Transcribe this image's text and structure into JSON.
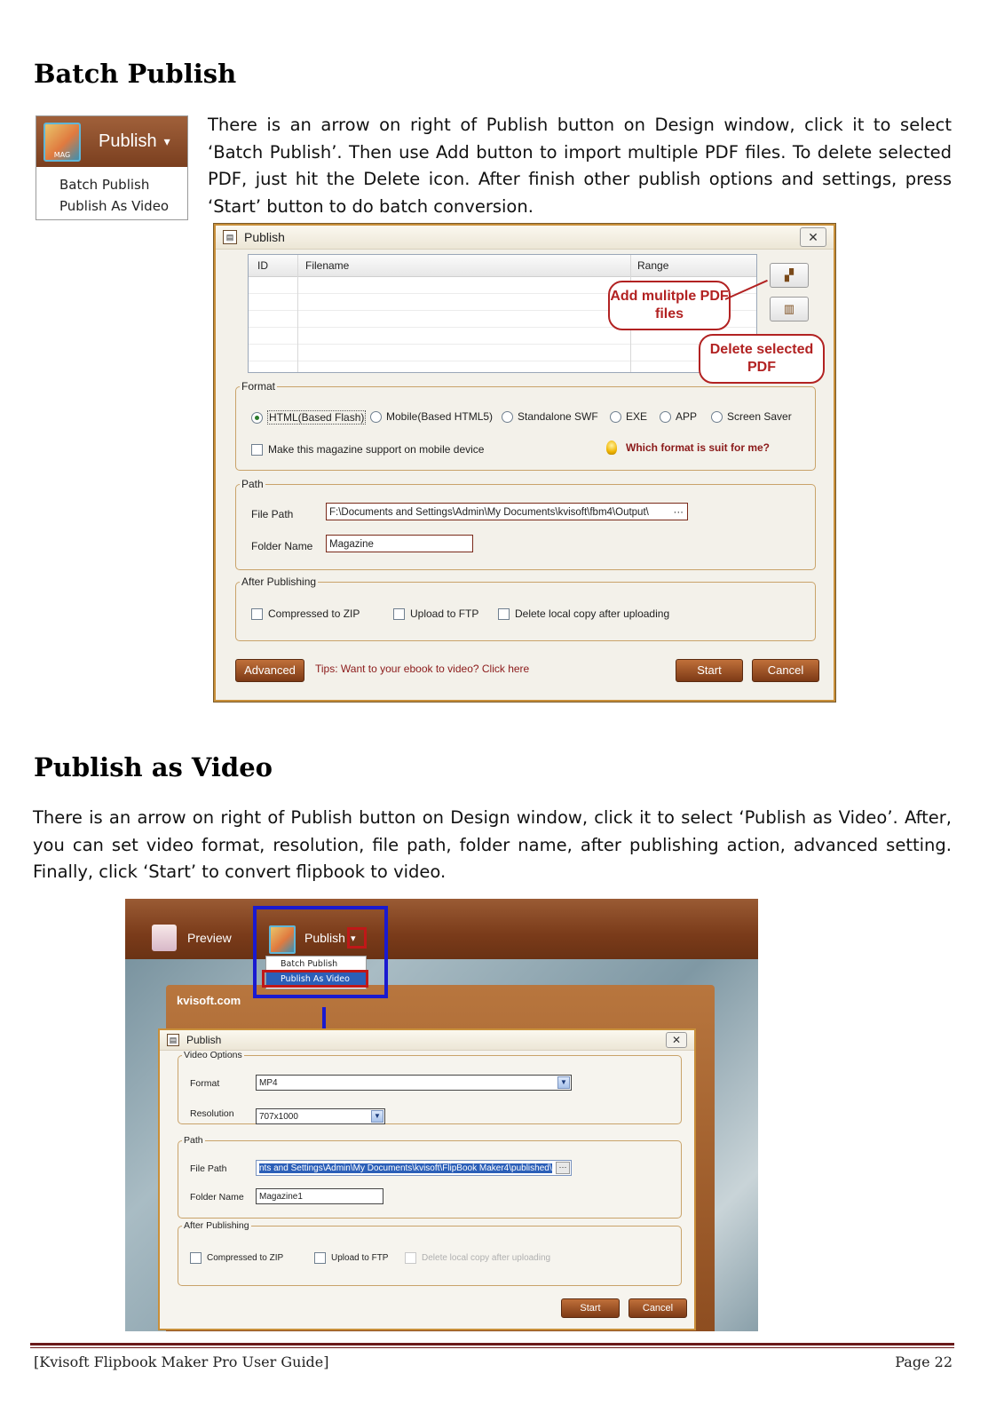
{
  "section1": {
    "heading": "Batch Publish",
    "paragraph": "There is an arrow on right of Publish button on Design window, click it to select ‘Batch Publish’. Then use Add button to import multiple PDF files. To delete selected PDF, just hit the Delete icon. After finish other publish options and settings, press ‘Start’ button to do batch conversion."
  },
  "menu_figure": {
    "icon_text": "MAG",
    "button_label": "Publish",
    "arrow": "▾",
    "items": [
      "Batch Publish",
      "Publish As Video"
    ]
  },
  "dialog1": {
    "title": "Publish",
    "close": "✕",
    "grid_columns": [
      "ID",
      "Filename",
      "Range"
    ],
    "add_icon": "add-files-icon",
    "delete_icon": "trash-icon",
    "callout_add": "Add mulitple PDF files",
    "callout_delete": "Delete selected PDF",
    "format": {
      "legend": "Format",
      "options": [
        "HTML(Based Flash)",
        "Mobile(Based HTML5)",
        "Standalone SWF",
        "EXE",
        "APP",
        "Screen Saver"
      ],
      "selected": "HTML(Based Flash)",
      "mobile_checkbox": "Make this magazine support on mobile device",
      "help_link": "Which format is suit for me?"
    },
    "path": {
      "legend": "Path",
      "file_path_label": "File Path",
      "file_path_value": "F:\\Documents and Settings\\Admin\\My Documents\\kvisoft\\fbm4\\Output\\",
      "browse": "···",
      "folder_name_label": "Folder Name",
      "folder_name_value": "Magazine"
    },
    "after": {
      "legend": "After Publishing",
      "options": [
        "Compressed to ZIP",
        "Upload to FTP",
        "Delete local copy after uploading"
      ]
    },
    "advanced_button": "Advanced",
    "tips": "Tips: Want to your ebook to video? Click here",
    "start_button": "Start",
    "cancel_button": "Cancel"
  },
  "section2": {
    "heading": "Publish as Video",
    "paragraph": "There is an arrow on right of Publish button on Design window, click it to select ‘Publish as Video’. After, you can set video format, resolution, file path, folder name, after publishing action, advanced setting. Finally, click ‘Start’ to convert flipbook to video."
  },
  "figure2": {
    "toolbar": {
      "preview": "Preview",
      "publish": "Publish",
      "arrow": "▾"
    },
    "menu_items": [
      "Batch Publish",
      "Publish As Video"
    ],
    "brand": "kvisoft.com",
    "dialog": {
      "title": "Publish",
      "close": "✕",
      "video_options_legend": "Video Options",
      "format_label": "Format",
      "format_value": "MP4",
      "resolution_label": "Resolution",
      "resolution_value": "707x1000",
      "path_legend": "Path",
      "file_path_label": "File Path",
      "file_path_value": "nts and Settings\\Admin\\My Documents\\kvisoft\\FlipBook Maker4\\published\\",
      "browse": "···",
      "folder_name_label": "Folder Name",
      "folder_name_value": "Magazine1",
      "after_legend": "After Publishing",
      "after_options": [
        "Compressed to ZIP",
        "Upload to FTP",
        "Delete local copy after uploading"
      ],
      "start_button": "Start",
      "cancel_button": "Cancel"
    }
  },
  "footer": {
    "left": "[Kvisoft Flipbook Maker Pro User Guide]",
    "right": "Page 22"
  }
}
